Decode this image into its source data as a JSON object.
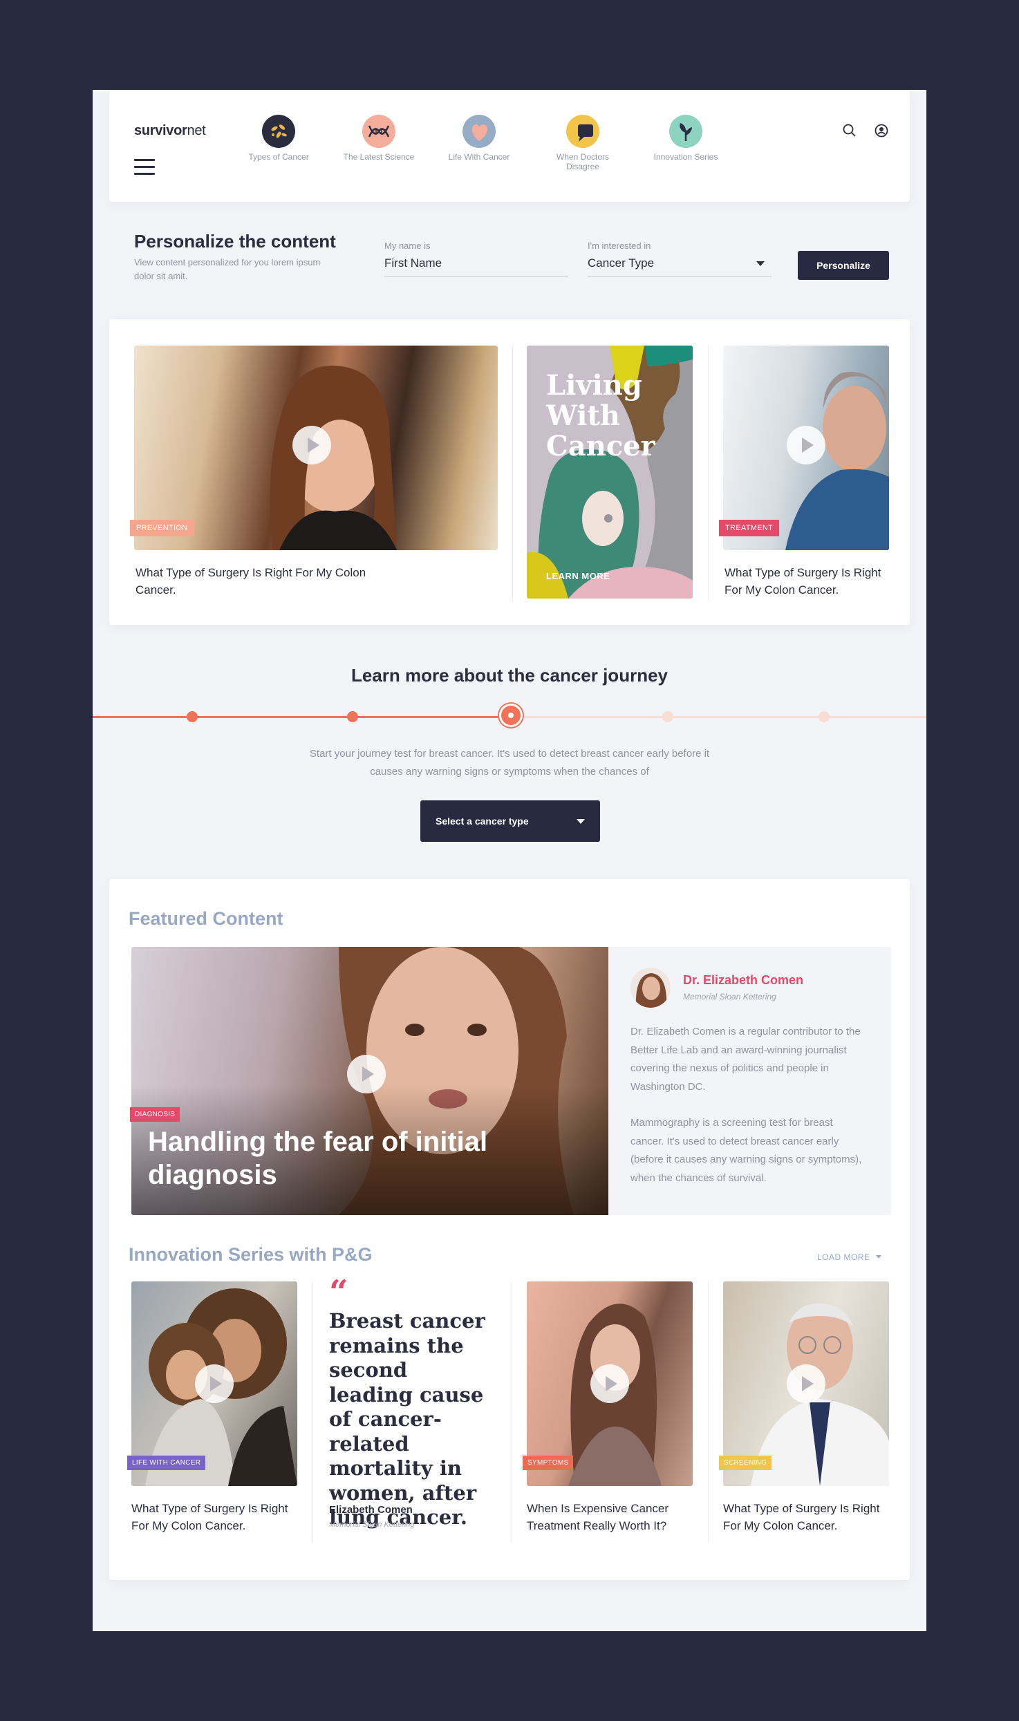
{
  "header": {
    "logo_bold": "survivor",
    "logo_light": "net",
    "nav": [
      {
        "label": "Types of Cancer",
        "icon": "bacteria-icon",
        "color": "#2b2d3f"
      },
      {
        "label": "The Latest Science",
        "icon": "dna-icon",
        "color": "#f4ad9b"
      },
      {
        "label": "Life With Cancer",
        "icon": "heart-icon",
        "color": "#96abc6"
      },
      {
        "label": "When Doctors Disagree",
        "icon": "speech-bubble-icon",
        "color": "#f2c44a"
      },
      {
        "label": "Innovation Series",
        "icon": "plant-icon",
        "color": "#8ed2c0"
      }
    ]
  },
  "personalize": {
    "title": "Personalize the content",
    "description": "View content personalized for you lorem ipsum dolor sit amit.",
    "name_label": "My name is",
    "name_value": "First Name",
    "interest_label": "I'm interested in",
    "interest_value": "Cancer Type",
    "button": "Personalize"
  },
  "carousel": [
    {
      "tag": "PREVENTION",
      "tag_color": "#f4a58c",
      "title": "What Type of Surgery Is Right For My Colon Cancer."
    },
    {
      "poster_title": "Living With Cancer",
      "cta": "LEARN MORE"
    },
    {
      "tag": "TREATMENT",
      "tag_color": "#e34a67",
      "title": "What Type of Surgery Is Right For My Colon Cancer."
    }
  ],
  "journey": {
    "title": "Learn more about the cancer journey",
    "text": "Start your journey test for breast cancer. It's used to detect breast cancer early before it causes any warning signs or symptoms when the chances of",
    "select": "Select a cancer type",
    "progress_step": 3,
    "steps_total": 5
  },
  "featured": {
    "section_title": "Featured Content",
    "tag": "DIAGNOSIS",
    "headline": "Handling the fear of initial diagnosis",
    "author_name": "Dr. Elizabeth Comen",
    "author_org": "Memorial Sloan Kettering",
    "bio_1": "Dr. Elizabeth Comen is a regular contributor to the Better Life Lab and an award-winning journalist covering the nexus of politics and people in Washington DC.",
    "bio_2": "Mammography is a screening test for breast cancer. It's used to detect breast cancer early (before it causes any warning signs or symptoms), when the chances of survival."
  },
  "innovation": {
    "section_title": "Innovation Series with P&G",
    "load_more": "LOAD MORE",
    "cards": [
      {
        "tag": "LIFE WITH CANCER",
        "tag_color": "#7a63c8",
        "title": "What Type of Surgery Is Right For My Colon Cancer."
      },
      {
        "quote_mark": "“",
        "quote": "Breast cancer remains the second leading cause of cancer-related mortality in women, after lung cancer.",
        "author": "Elizabeth Comen",
        "org": "Memorial Sloan Kettering"
      },
      {
        "tag": "SYMPTOMS",
        "tag_color": "#ef6a52",
        "title": "When Is Expensive Cancer Treatment Really Worth It?"
      },
      {
        "tag": "SCREENING",
        "tag_color": "#f2c44a",
        "title": "What Type of Surgery Is Right For My Colon Cancer."
      }
    ]
  }
}
